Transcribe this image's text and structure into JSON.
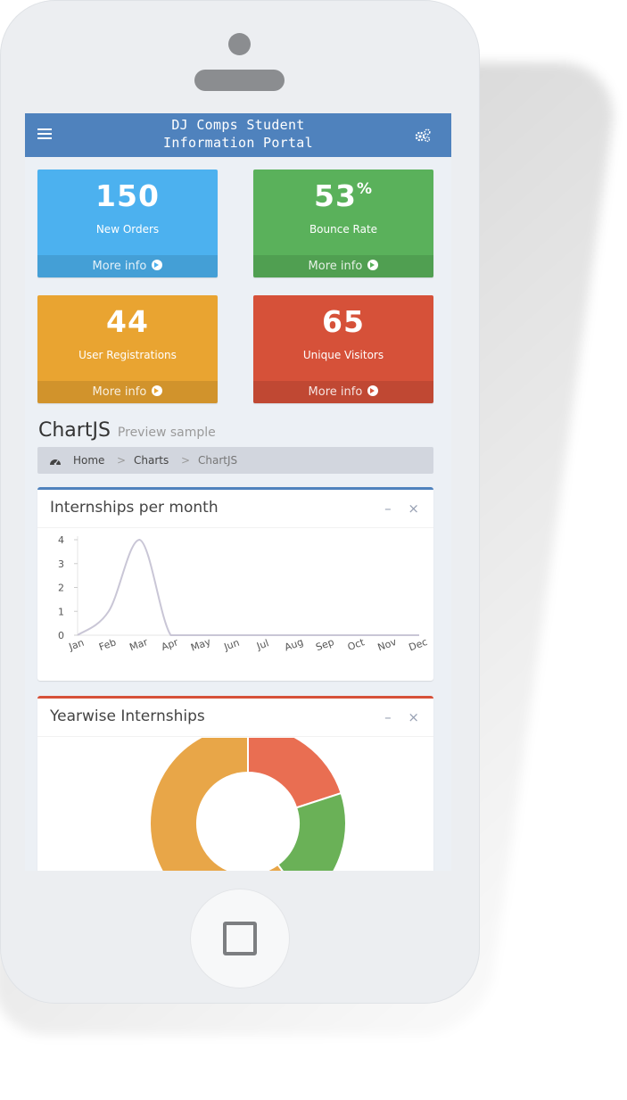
{
  "app": {
    "title_line1": "DJ Comps Student",
    "title_line2": "Information Portal"
  },
  "stats": [
    {
      "value": "150",
      "suffix": "",
      "label": "New Orders",
      "link": "More info",
      "color": "#4cb1ef"
    },
    {
      "value": "53",
      "suffix": "%",
      "label": "Bounce Rate",
      "link": "More info",
      "color": "#5ab15b"
    },
    {
      "value": "44",
      "suffix": "",
      "label": "User Registrations",
      "link": "More info",
      "color": "#e9a431"
    },
    {
      "value": "65",
      "suffix": "",
      "label": "Unique Visitors",
      "link": "More info",
      "color": "#d65139"
    }
  ],
  "page": {
    "title": "ChartJS",
    "subtitle": "Preview sample"
  },
  "breadcrumb": {
    "home": "Home",
    "sep": ">",
    "charts": "Charts",
    "current": "ChartJS"
  },
  "card1": {
    "title": "Internships per month",
    "minimize": "–",
    "close": "×"
  },
  "card2": {
    "title": "Yearwise Internships",
    "minimize": "–",
    "close": "×"
  },
  "chart_data": [
    {
      "type": "line",
      "title": "Internships per month",
      "categories": [
        "Jan",
        "Feb",
        "Mar",
        "Apr",
        "May",
        "Jun",
        "Jul",
        "Aug",
        "Sep",
        "Oct",
        "Nov",
        "Dec"
      ],
      "series": [
        {
          "values": [
            0,
            1,
            4,
            0,
            0,
            0,
            0,
            0,
            0,
            0,
            0,
            0
          ]
        }
      ],
      "ylim": [
        0,
        4
      ],
      "yticks": [
        "0",
        "1",
        "2",
        "3",
        "4"
      ],
      "line_color": "#c9c6d6"
    },
    {
      "type": "pie",
      "title": "Yearwise Internships",
      "values": [
        20,
        20,
        60
      ],
      "colors": [
        "#e96e52",
        "#6ab157",
        "#e8a648"
      ]
    }
  ],
  "colors": {
    "header": "#4f82bd",
    "card1_border": "#4f82bd",
    "card2_border": "#d65139"
  }
}
